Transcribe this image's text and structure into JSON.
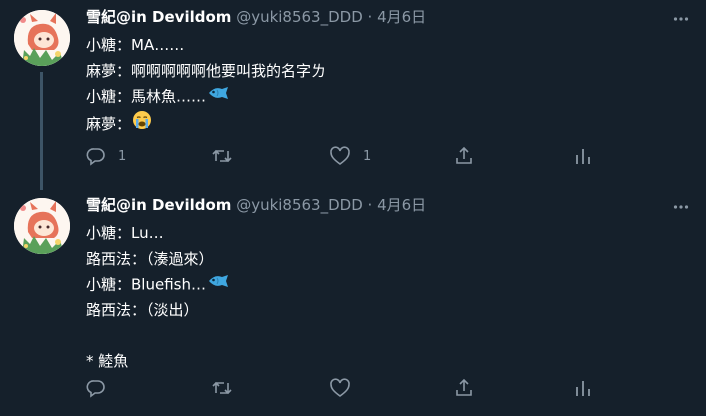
{
  "tweets": [
    {
      "author": {
        "name": "雪紀@in Devildom",
        "handle": "@yuki8563_DDD",
        "separator": "·",
        "date": "4月6日"
      },
      "lines": [
        "小糖：MA……",
        "麻夢：啊啊啊啊啊他要叫我的名字ㄌ",
        "小糖：馬林魚……",
        "麻夢："
      ],
      "line_emojis": [
        null,
        null,
        "fish-emoji",
        "crying-face-emoji"
      ],
      "actions": {
        "reply_count": "1",
        "retweet_count": "",
        "like_count": "1"
      }
    },
    {
      "author": {
        "name": "雪紀@in Devildom",
        "handle": "@yuki8563_DDD",
        "separator": "·",
        "date": "4月6日"
      },
      "lines": [
        "小糖：Lu…",
        "路西法：（湊過來）",
        "小糖：Bluefish…",
        "路西法：（淡出）",
        "",
        "* 鯥魚"
      ],
      "line_emojis": [
        null,
        null,
        "fish-emoji",
        null,
        null,
        null
      ],
      "actions": {
        "reply_count": "",
        "retweet_count": "",
        "like_count": ""
      }
    }
  ],
  "colors": {
    "background": "#15202b",
    "secondary_text": "#8b98a5",
    "thread_line": "#3d5466"
  }
}
